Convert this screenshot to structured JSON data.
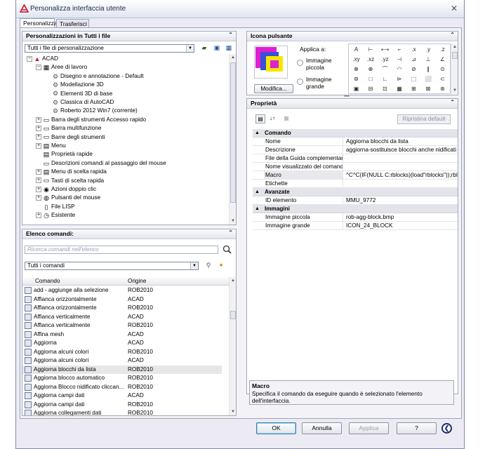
{
  "window": {
    "title": "Personalizza interfaccia utente",
    "close_glyph": "✕"
  },
  "tabs": [
    "Personalizza",
    "Trasferisci"
  ],
  "customizations_panel": {
    "title": "Personalizzazioni in Tutti i file",
    "collapse_glyph": "⌃",
    "filter_value": "Tutti i file di personalizzazione",
    "tree": [
      {
        "label": "ACAD",
        "level": 0,
        "expander": "−",
        "icon": "acad-icon"
      },
      {
        "label": "Aree di lavoro",
        "level": 1,
        "expander": "−",
        "icon": "workspace-icon"
      },
      {
        "label": "Disegno e annotazione - Default",
        "level": 2,
        "expander": "",
        "icon": "gear-icon"
      },
      {
        "label": "Modellazione 3D",
        "level": 2,
        "expander": "",
        "icon": "gear-icon"
      },
      {
        "label": "Elementi 3D di base",
        "level": 2,
        "expander": "",
        "icon": "gear-icon"
      },
      {
        "label": "Classica di AutoCAD",
        "level": 2,
        "expander": "",
        "icon": "gear-icon"
      },
      {
        "label": "Roberto 2012 Win7 (corrente)",
        "level": 2,
        "expander": "",
        "icon": "gear-icon"
      },
      {
        "label": "Barra degli strumenti Accesso rapido",
        "level": 1,
        "expander": "+",
        "icon": "quick-access-icon"
      },
      {
        "label": "Barra multifunzione",
        "level": 1,
        "expander": "+",
        "icon": "ribbon-icon"
      },
      {
        "label": "Barre degli strumenti",
        "level": 1,
        "expander": "+",
        "icon": "toolbar-icon"
      },
      {
        "label": "Menu",
        "level": 1,
        "expander": "+",
        "icon": "menu-icon"
      },
      {
        "label": "Proprietà rapide",
        "level": 1,
        "expander": "",
        "icon": "quick-properties-icon"
      },
      {
        "label": "Descrizioni comandi al passaggio del mouse",
        "level": 1,
        "expander": "",
        "icon": "tooltip-icon"
      },
      {
        "label": "Menu di scelta rapida",
        "level": 1,
        "expander": "+",
        "icon": "shortcut-menu-icon"
      },
      {
        "label": "Tasti di scelta rapida",
        "level": 1,
        "expander": "+",
        "icon": "keyboard-icon"
      },
      {
        "label": "Azioni doppio clic",
        "level": 1,
        "expander": "+",
        "icon": "double-click-icon"
      },
      {
        "label": "Pulsanti del mouse",
        "level": 1,
        "expander": "+",
        "icon": "mouse-icon"
      },
      {
        "label": "File LISP",
        "level": 1,
        "expander": "",
        "icon": "lisp-file-icon"
      },
      {
        "label": "Esistente",
        "level": 1,
        "expander": "+",
        "icon": "legacy-icon"
      }
    ]
  },
  "commands_panel": {
    "title": "Elenco comandi:",
    "collapse_glyph": "⌃",
    "search_placeholder": "Ricerca comandi nell'elenco",
    "filter_value": "Tutti i comandi",
    "col_command": "Comando",
    "col_origin": "Origine",
    "rows": [
      {
        "name": "add - aggiunge alla selezione",
        "origin": "ROB2010",
        "icon": "add-selection-icon"
      },
      {
        "name": "Affianca orizzontalmente",
        "origin": "ACAD",
        "icon": "tile-horizontal-icon"
      },
      {
        "name": "Affianca orizzontalmente",
        "origin": "ROB2010",
        "icon": "tile-horizontal-icon"
      },
      {
        "name": "Affianca verticalmente",
        "origin": "ACAD",
        "icon": "tile-vertical-icon"
      },
      {
        "name": "Affianca verticalmente",
        "origin": "ROB2010",
        "icon": "tile-vertical-icon"
      },
      {
        "name": "Affina mesh",
        "origin": "ACAD",
        "icon": "refine-mesh-icon"
      },
      {
        "name": "Aggiorna",
        "origin": "ACAD",
        "icon": "update-icon"
      },
      {
        "name": "Aggiorna alcuni colori",
        "origin": "ROB2010",
        "icon": "update-colors-icon"
      },
      {
        "name": "Aggiorna alcuni colori",
        "origin": "ACAD",
        "icon": "update-colors-icon"
      },
      {
        "name": "Aggiorna blocchi da lista",
        "origin": "ROB2010",
        "icon": "update-blocks-icon",
        "selected": true
      },
      {
        "name": "Aggiorna blocco automatico",
        "origin": "ROB2010",
        "icon": "update-block-auto-icon"
      },
      {
        "name": "Aggiorna Blocco nidificato cliccan...",
        "origin": "ROB2010",
        "icon": "nested-block-icon"
      },
      {
        "name": "Aggiorna campi dati",
        "origin": "ACAD",
        "icon": "update-fields-icon"
      },
      {
        "name": "Aggiorna campi dati",
        "origin": "ROB2010",
        "icon": "update-fields-icon"
      },
      {
        "name": "Aggiorna collegamenti dati",
        "origin": "ROB2010",
        "icon": "update-links-icon"
      }
    ]
  },
  "button_image_panel": {
    "title": "Icona pulsante",
    "collapse_glyph": "⌃",
    "apply_label": "Applica a:",
    "small_image_label": "Immagine piccola",
    "large_image_label": "Immagine grande",
    "edit_button": "Modifica...",
    "icon_glyphs": [
      "A",
      "⊢",
      "⟷",
      "⌐",
      ".x",
      ".y",
      ".z",
      ".xy",
      ".xz",
      ".yz",
      "⊣",
      "⊿",
      "⊥",
      "∠",
      "⊗",
      "⊕",
      "⌒",
      "◠",
      "⊘",
      "∥",
      "⊙",
      "⊚",
      "□",
      "∟",
      "⊳",
      "⬚",
      "⬜",
      "⊂",
      "▣",
      "⊟",
      "⊡",
      "▦",
      "⊞",
      "⊠",
      "⊛"
    ]
  },
  "properties_panel": {
    "title": "Proprietà",
    "collapse_glyph": "⌃",
    "reset_button": "Ripristina default",
    "toolbar_glyphs": [
      "▤",
      "↓↑",
      "▦"
    ],
    "categories": [
      {
        "name": "Comando",
        "rows": [
          {
            "key": "Nome",
            "value": "Aggiorna blocchi da lista"
          },
          {
            "key": "Descrizione",
            "value": "aggiorna-sostituisce blocchi anche nidificati"
          },
          {
            "key": "File della Guida complementare",
            "value": ""
          },
          {
            "key": "Nome visualizzato del comando",
            "value": ""
          },
          {
            "key": "Macro",
            "value": "^C^C(IF(NULL C:rblocks)(load\"rblocks\"));rblocks;",
            "selected": true
          },
          {
            "key": "Etichette",
            "value": ""
          }
        ]
      },
      {
        "name": "Avanzate",
        "rows": [
          {
            "key": "ID elemento",
            "value": "MMU_9772"
          }
        ]
      },
      {
        "name": "Immagini",
        "rows": [
          {
            "key": "Immagine piccola",
            "value": "rob-agg-block.bmp"
          },
          {
            "key": "Immagine grande",
            "value": "ICON_24_BLOCK"
          }
        ]
      }
    ],
    "description_title": "Macro",
    "description_text": "Specifica il comando da eseguire quando è selezionato l'elemento dell'interfaccia."
  },
  "footer": {
    "ok": "OK",
    "cancel": "Annulla",
    "apply": "Applica",
    "help": "?",
    "expand_glyph": "❮"
  },
  "colors": {
    "window_bg": "#eceaf2",
    "title_text": "#1c2a44",
    "icon_magenta": "#e020d0",
    "icon_yellow": "#f5e800",
    "icon_blue": "#3c4fd6"
  }
}
